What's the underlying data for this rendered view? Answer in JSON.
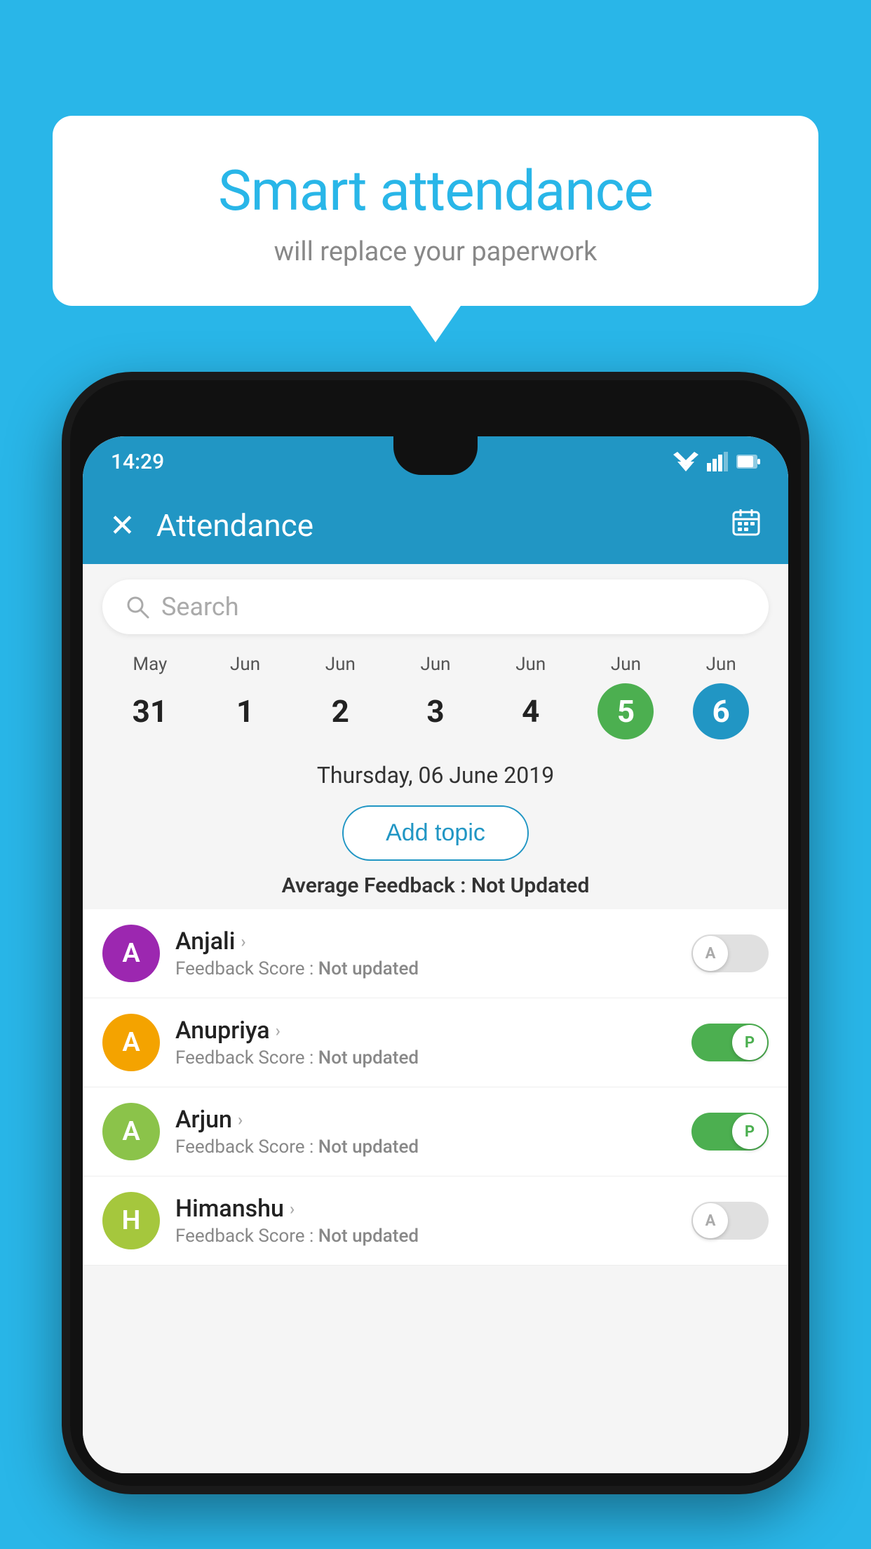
{
  "background_color": "#29b6e8",
  "bubble": {
    "title": "Smart attendance",
    "subtitle": "will replace your paperwork"
  },
  "phone": {
    "status_bar": {
      "time": "14:29"
    },
    "app_bar": {
      "title": "Attendance",
      "close_icon": "✕",
      "calendar_icon": "📅"
    },
    "search": {
      "placeholder": "Search"
    },
    "dates": [
      {
        "month": "May",
        "day": "31",
        "state": "normal"
      },
      {
        "month": "Jun",
        "day": "1",
        "state": "normal"
      },
      {
        "month": "Jun",
        "day": "2",
        "state": "normal"
      },
      {
        "month": "Jun",
        "day": "3",
        "state": "normal"
      },
      {
        "month": "Jun",
        "day": "4",
        "state": "normal"
      },
      {
        "month": "Jun",
        "day": "5",
        "state": "today"
      },
      {
        "month": "Jun",
        "day": "6",
        "state": "selected"
      }
    ],
    "selected_date_label": "Thursday, 06 June 2019",
    "add_topic_label": "Add topic",
    "avg_feedback_prefix": "Average Feedback : ",
    "avg_feedback_value": "Not Updated",
    "students": [
      {
        "name": "Anjali",
        "initial": "A",
        "avatar_color": "#9c27b0",
        "feedback_label": "Feedback Score : ",
        "feedback_value": "Not updated",
        "toggle_state": "off",
        "toggle_letter": "A"
      },
      {
        "name": "Anupriya",
        "initial": "A",
        "avatar_color": "#f4a300",
        "feedback_label": "Feedback Score : ",
        "feedback_value": "Not updated",
        "toggle_state": "on",
        "toggle_letter": "P"
      },
      {
        "name": "Arjun",
        "initial": "A",
        "avatar_color": "#8bc34a",
        "feedback_label": "Feedback Score : ",
        "feedback_value": "Not updated",
        "toggle_state": "on",
        "toggle_letter": "P"
      },
      {
        "name": "Himanshu",
        "initial": "H",
        "avatar_color": "#a5c73d",
        "feedback_label": "Feedback Score : ",
        "feedback_value": "Not updated",
        "toggle_state": "off",
        "toggle_letter": "A"
      }
    ]
  }
}
